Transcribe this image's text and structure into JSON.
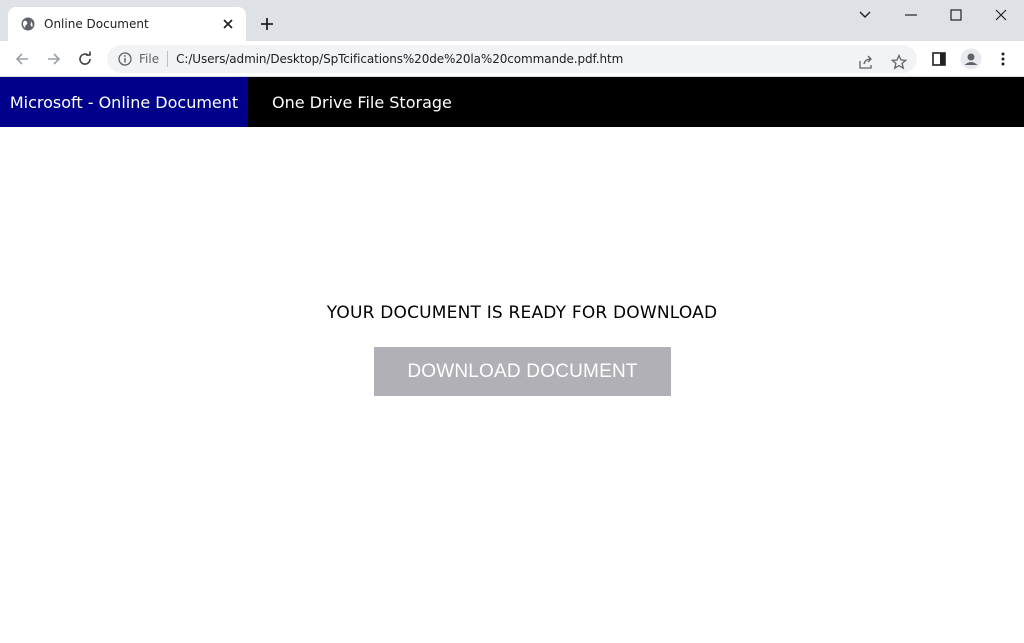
{
  "browser": {
    "tab": {
      "title": "Online Document",
      "favicon": "globe-icon"
    },
    "address": {
      "scheme_label": "File",
      "url": "C:/Users/admin/Desktop/SpTcifications%20de%20la%20commande.pdf.htm"
    }
  },
  "site": {
    "brand": "Microsoft - Online Document",
    "nav_link": "One Drive File Storage",
    "message": "YOUR DOCUMENT IS READY FOR DOWNLOAD",
    "button_label": "DOWNLOAD DOCUMENT"
  },
  "colors": {
    "brand_bg": "#00008b",
    "nav_bg": "#000000",
    "button_bg": "#b1b0b6",
    "chrome_bg": "#dee1e6"
  }
}
